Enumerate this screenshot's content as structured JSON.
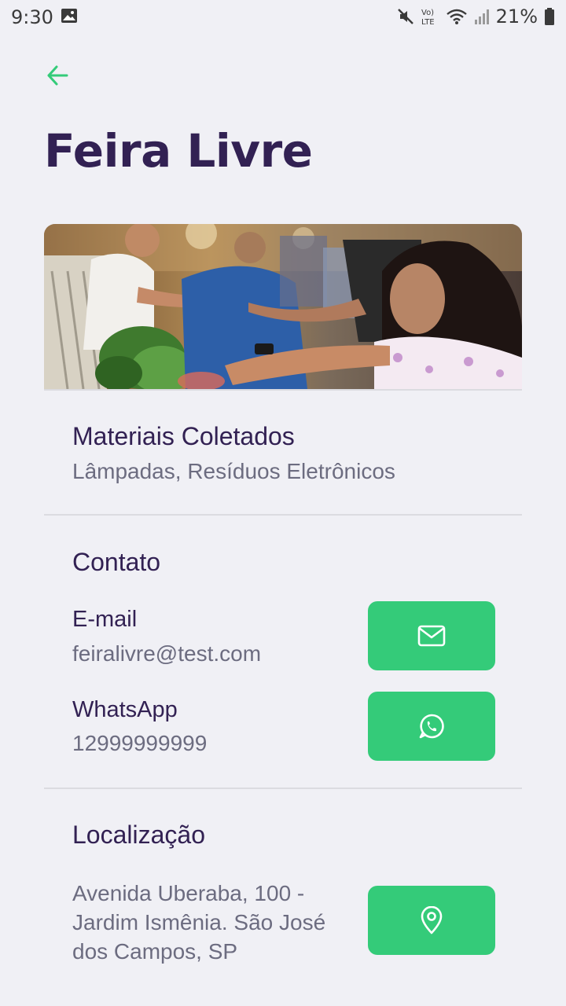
{
  "status_bar": {
    "time": "9:30",
    "battery": "21%",
    "icons": [
      "gallery-icon",
      "mute-icon",
      "volte-icon",
      "wifi-icon",
      "signal-icon",
      "battery-icon"
    ]
  },
  "header": {
    "back_icon": "arrow-left-icon",
    "title": "Feira Livre"
  },
  "image": {
    "description_icon": "market-photo"
  },
  "materials": {
    "title": "Materiais Coletados",
    "value": "Lâmpadas, Resíduos Eletrônicos"
  },
  "contact": {
    "title": "Contato",
    "email_label": "E-mail",
    "email_value": "feiralivre@test.com",
    "email_icon": "mail-icon",
    "whatsapp_label": "WhatsApp",
    "whatsapp_value": "12999999999",
    "whatsapp_icon": "whatsapp-icon"
  },
  "location": {
    "title": "Localização",
    "address": "Avenida Uberaba, 100 - Jardim Ismênia. São José dos Campos, SP",
    "map_icon": "map-pin-icon"
  },
  "colors": {
    "primary": "#34CB79",
    "title": "#322153",
    "text": "#6C6C80",
    "background": "#F0F0F5",
    "divider": "#DBDBE0"
  }
}
